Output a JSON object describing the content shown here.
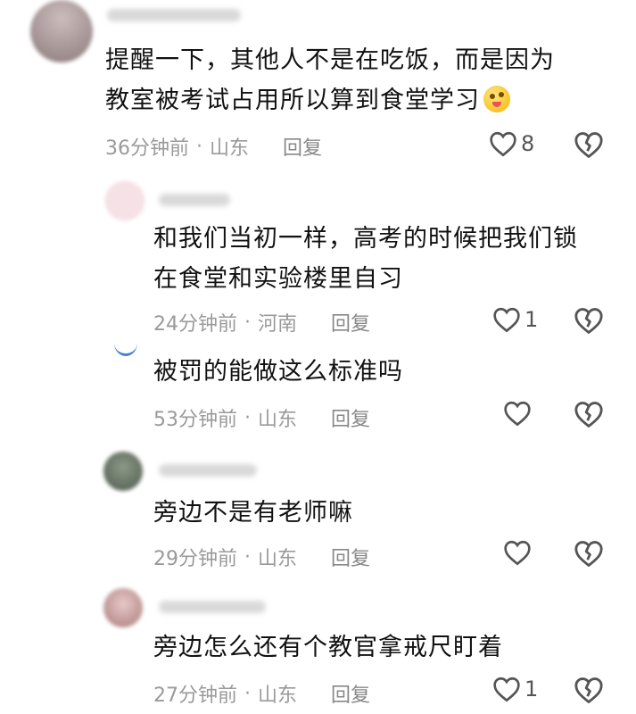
{
  "comments": [
    {
      "text_lines": [
        "提醒一下，其他人不是在吃饭，而是因为",
        "教室被考试占用所以算到食堂学习"
      ],
      "emoji": "grinning-tongue-emoji",
      "time": "36分钟前",
      "location": "山东",
      "reply_label": "回复",
      "likes": "8",
      "avatar_color": "#8a7a7a"
    },
    {
      "text_lines": [
        "和我们当初一样，高考的时候把我们锁",
        "在食堂和实验楼里自习"
      ],
      "time": "24分钟前",
      "location": "河南",
      "reply_label": "回复",
      "likes": "1",
      "avatar_color": "#f6e1e6"
    },
    {
      "text_lines": [
        "被罚的能做这么标准吗"
      ],
      "time": "53分钟前",
      "location": "山东",
      "reply_label": "回复",
      "likes": "",
      "avatar_color": "#4a7fd8"
    },
    {
      "text_lines": [
        "旁边不是有老师嘛"
      ],
      "time": "29分钟前",
      "location": "山东",
      "reply_label": "回复",
      "likes": "",
      "avatar_color": "#5c6b5a"
    },
    {
      "text_lines": [
        "旁边怎么还有个教官拿戒尺盯着"
      ],
      "time": "27分钟前",
      "location": "山东",
      "reply_label": "回复",
      "likes": "1",
      "avatar_color": "#b88a8a"
    }
  ],
  "separator": "·",
  "icons": {
    "like": "heart-outline-icon",
    "dislike": "broken-heart-icon"
  }
}
